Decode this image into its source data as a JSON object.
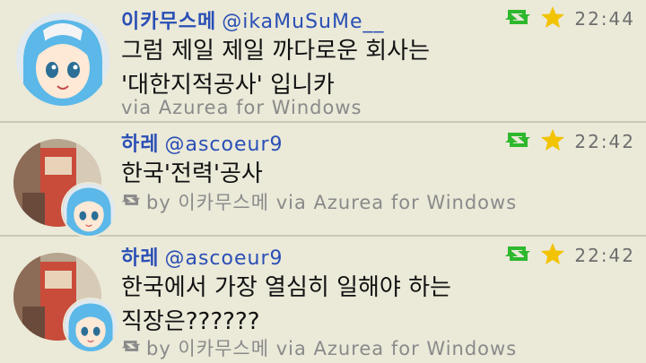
{
  "tweets": [
    {
      "name": "이카무스메",
      "handle": "@ikaMuSuMe__",
      "text_line1": "그럼 제일 제일 까다로운 회사는",
      "text_line2": "'대한지적공사' 입니카",
      "via": "via Azurea for Windows",
      "time": "22:44"
    },
    {
      "name": "하레",
      "handle": "@ascoeur9",
      "text_line1": "한국'전력'공사",
      "text_line2": "",
      "retweet_by": "by 이카무스메 via Azurea for Windows",
      "time": "22:42"
    },
    {
      "name": "하레",
      "handle": "@ascoeur9",
      "text_line1": "한국에서 가장 열심히 일해야 하는",
      "text_line2": "직장은??????",
      "retweet_by": "by 이카무스메 via Azurea for Windows",
      "time": "22:42"
    }
  ],
  "icons": {
    "retweet": "retweet-icon",
    "favorite": "star-icon",
    "retweet_small": "retweet-small-icon"
  },
  "colors": {
    "background": "#ebe9d8",
    "name": "#2a4fb5",
    "retweet_green": "#2eb82e",
    "star_yellow": "#f2c300",
    "meta_gray": "#8a8a8a"
  }
}
